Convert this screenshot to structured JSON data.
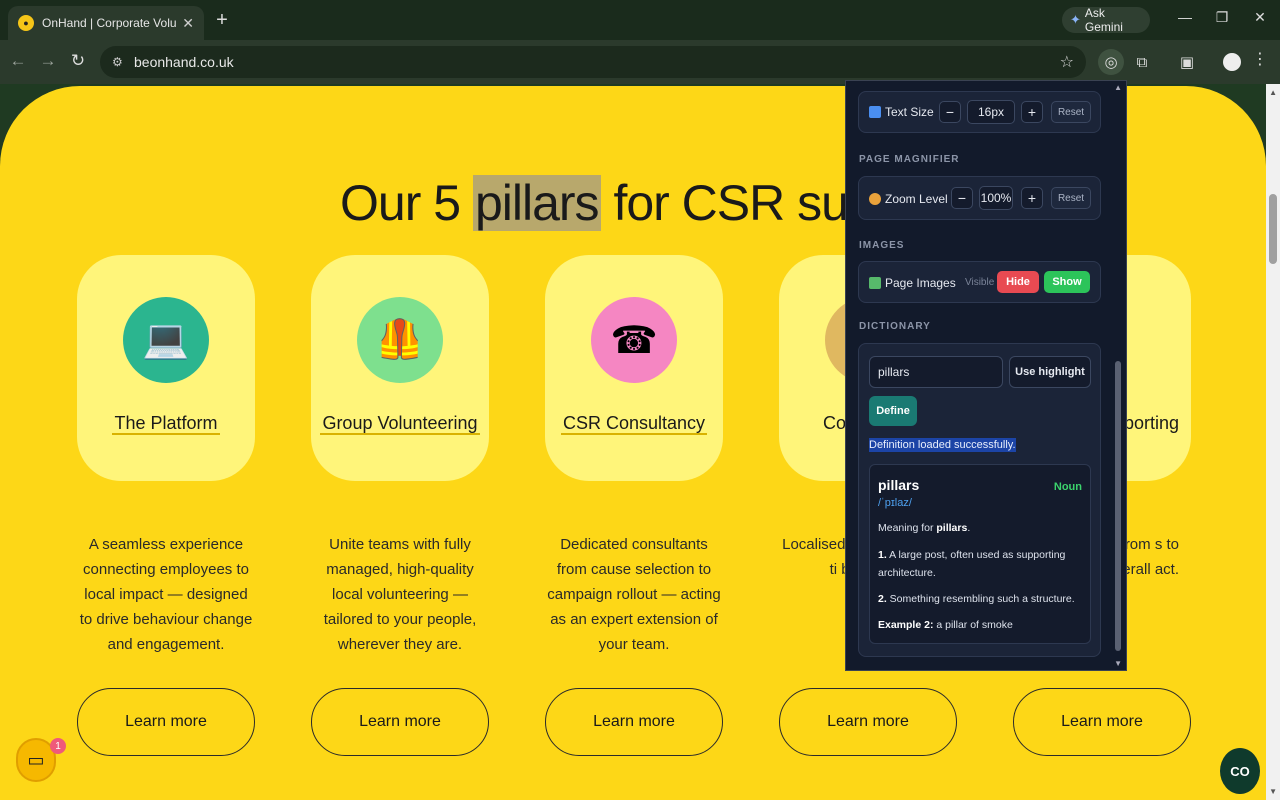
{
  "browser": {
    "tab_title": "OnHand | Corporate Volunteeri",
    "new_tab": "+",
    "ask_gemini": "Ask Gemini",
    "url": "beonhand.co.uk"
  },
  "page": {
    "headline_before": "Our 5 ",
    "headline_highlight": "pillars",
    "headline_after": " for CSR succ",
    "cards": [
      {
        "title": "The Platform",
        "desc": "A seamless experience connecting employees to local impact — designed to drive behaviour change and engagement.",
        "button": "Learn more"
      },
      {
        "title": "Group Volunteering",
        "desc": "Unite teams with fully managed, high-quality local volunteering — tailored to your people, wherever they are.",
        "button": "Learn more"
      },
      {
        "title": "CSR Consultancy",
        "desc": "Dedicated consultants from cause selection to campaign rollout — acting as an expert extension of your team.",
        "button": "Learn more"
      },
      {
        "title": "Co Ca",
        "desc": "Localised tailored o to-go, ti built to bo",
        "button": "Learn more"
      },
      {
        "title": "porting",
        "desc": "ess with ata — from s to team d overall act.",
        "button": "Learn more"
      }
    ],
    "chat_badge_count": "1",
    "co_button": "CO"
  },
  "panel": {
    "text_size": {
      "label": "Text Size",
      "value": "16px",
      "minus": "−",
      "plus": "+",
      "reset": "Reset"
    },
    "magnifier": {
      "section": "PAGE MAGNIFIER",
      "label": "Zoom Level",
      "value": "100%",
      "minus": "−",
      "plus": "+",
      "reset": "Reset"
    },
    "images": {
      "section": "IMAGES",
      "label": "Page Images",
      "visible": "Visible",
      "hide": "Hide",
      "show": "Show"
    },
    "dictionary": {
      "section": "DICTIONARY",
      "input_value": "pillars",
      "use_highlight": "Use highlight",
      "define": "Define",
      "status": "Definition loaded successfully.",
      "word": "pillars",
      "part_of_speech": "Noun",
      "phonetic": "/ˈpɪlaz/",
      "meaning_prefix": "Meaning for ",
      "meaning_word": "pillars",
      "meaning_suffix": ".",
      "def1_num": "1.",
      "def1": " A large post, often used as supporting architecture.",
      "def2_num": "2.",
      "def2": " Something resembling such a structure.",
      "example_label": "Example 2:",
      "example": " a pillar of smoke"
    }
  },
  "colors": {
    "page_yellow": "#fdd717",
    "card_yellow": "#fff57a",
    "panel_bg": "#121a2b",
    "hide_red": "#e84a52",
    "show_green": "#2cc45a",
    "define_teal": "#1a7a73"
  }
}
